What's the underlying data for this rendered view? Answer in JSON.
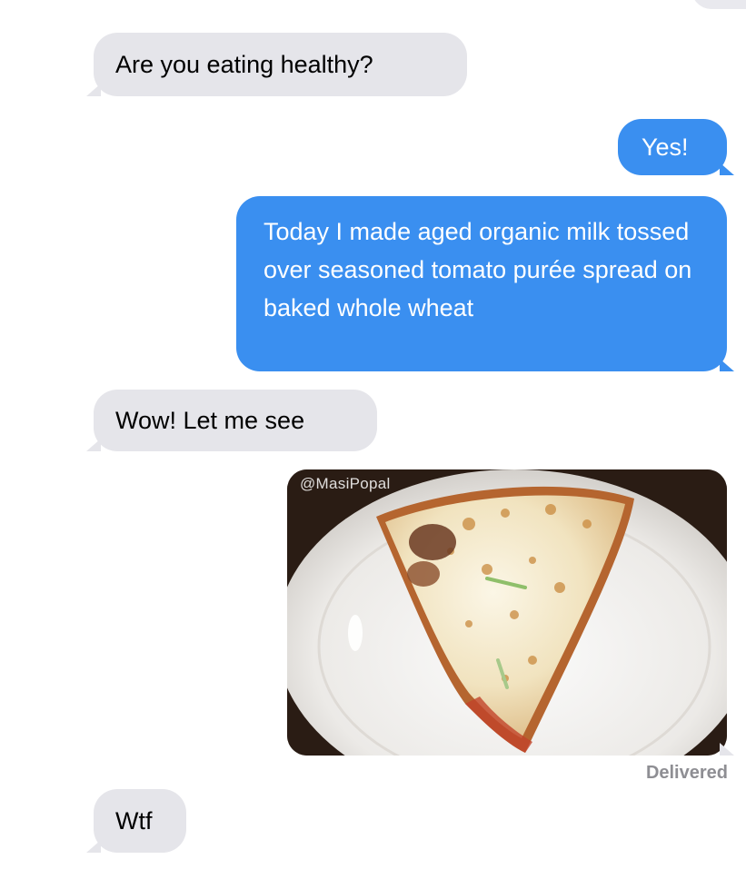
{
  "messages": [
    {
      "side": "received",
      "text": "Are you eating healthy?"
    },
    {
      "side": "sent",
      "text": "Yes!"
    },
    {
      "side": "sent",
      "text": "Today I made aged organic milk tossed over seasoned tomato purée spread on baked whole wheat"
    },
    {
      "side": "received",
      "text": "Wow! Let me see"
    },
    {
      "side": "sent",
      "type": "image",
      "image_subject": "slice of cheese pizza on a white plate",
      "watermark": "@MasiPopal"
    },
    {
      "side": "received",
      "text": "Wtf"
    }
  ],
  "status": {
    "delivered_label": "Delivered"
  },
  "colors": {
    "sent_bubble": "#3a8ff0",
    "received_bubble": "#e5e5ea",
    "status_text": "#8e8e93"
  }
}
